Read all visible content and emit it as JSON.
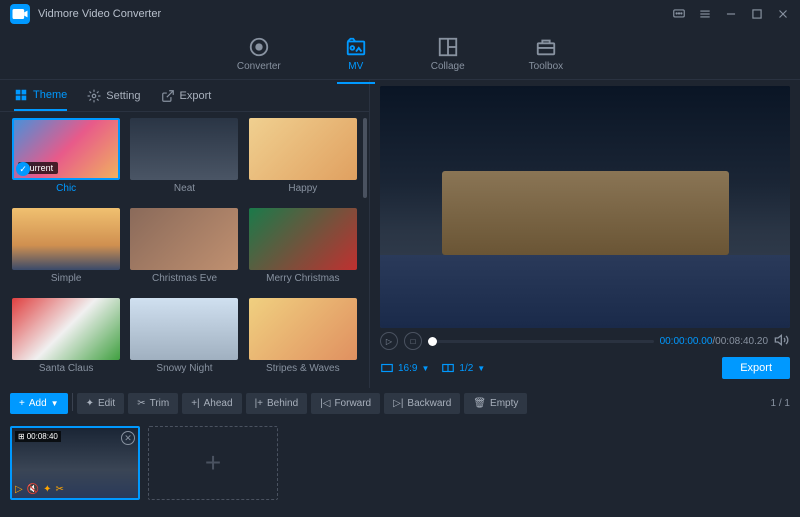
{
  "app": {
    "title": "Vidmore Video Converter"
  },
  "nav": [
    {
      "label": "Converter",
      "icon": "converter"
    },
    {
      "label": "MV",
      "icon": "mv"
    },
    {
      "label": "Collage",
      "icon": "collage"
    },
    {
      "label": "Toolbox",
      "icon": "toolbox"
    }
  ],
  "subtabs": [
    {
      "label": "Theme"
    },
    {
      "label": "Setting"
    },
    {
      "label": "Export"
    }
  ],
  "themes": [
    {
      "label": "Chic",
      "current": true,
      "selected": true
    },
    {
      "label": "Neat"
    },
    {
      "label": "Happy"
    },
    {
      "label": "Simple"
    },
    {
      "label": "Christmas Eve"
    },
    {
      "label": "Merry Christmas"
    },
    {
      "label": "Santa Claus"
    },
    {
      "label": "Snowy Night"
    },
    {
      "label": "Stripes & Waves"
    }
  ],
  "current_badge": "Current",
  "player": {
    "time_current": "00:00:00.00",
    "time_total": "00:08:40.20",
    "aspect": "16:9",
    "split": "1/2"
  },
  "export_label": "Export",
  "toolbar": [
    {
      "label": "Add",
      "icon": "plus",
      "primary": true,
      "dropdown": true
    },
    {
      "label": "Edit",
      "icon": "wand"
    },
    {
      "label": "Trim",
      "icon": "scissors"
    },
    {
      "label": "Ahead",
      "icon": "ahead"
    },
    {
      "label": "Behind",
      "icon": "behind"
    },
    {
      "label": "Forward",
      "icon": "forward"
    },
    {
      "label": "Backward",
      "icon": "backward"
    },
    {
      "label": "Empty",
      "icon": "trash"
    }
  ],
  "pager": "1 / 1",
  "clip": {
    "duration": "00:08:40"
  }
}
